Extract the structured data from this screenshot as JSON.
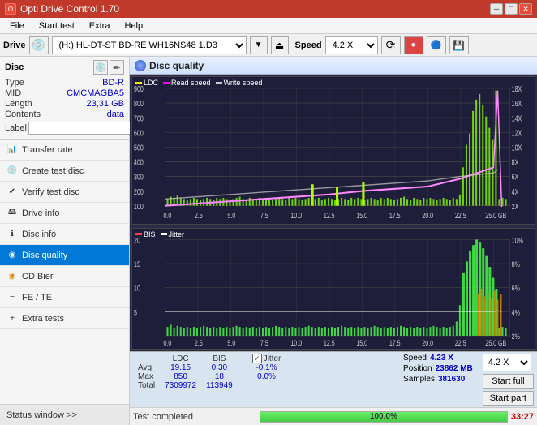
{
  "titleBar": {
    "title": "Opti Drive Control 1.70",
    "minBtn": "─",
    "maxBtn": "□",
    "closeBtn": "✕"
  },
  "menuBar": {
    "items": [
      "File",
      "Start test",
      "Extra",
      "Help"
    ]
  },
  "driveBar": {
    "label": "Drive",
    "driveValue": "(H:) HL-DT-ST BD-RE  WH16NS48 1.D3",
    "speedLabel": "Speed",
    "speedValue": "4.2 X"
  },
  "sidebar": {
    "discTitle": "Disc",
    "discInfo": {
      "type": {
        "key": "Type",
        "val": "BD-R"
      },
      "mid": {
        "key": "MID",
        "val": "CMCMAGBA5"
      },
      "length": {
        "key": "Length",
        "val": "23,31 GB"
      },
      "contents": {
        "key": "Contents",
        "val": "data"
      },
      "label": "Label"
    },
    "navItems": [
      {
        "id": "transfer-rate",
        "label": "Transfer rate",
        "active": false
      },
      {
        "id": "create-test-disc",
        "label": "Create test disc",
        "active": false
      },
      {
        "id": "verify-test-disc",
        "label": "Verify test disc",
        "active": false
      },
      {
        "id": "drive-info",
        "label": "Drive info",
        "active": false
      },
      {
        "id": "disc-info",
        "label": "Disc info",
        "active": false
      },
      {
        "id": "disc-quality",
        "label": "Disc quality",
        "active": true
      },
      {
        "id": "cd-bier",
        "label": "CD Bier",
        "active": false
      },
      {
        "id": "fe-te",
        "label": "FE / TE",
        "active": false
      },
      {
        "id": "extra-tests",
        "label": "Extra tests",
        "active": false
      }
    ],
    "statusWindowBtn": "Status window >>"
  },
  "discQuality": {
    "title": "Disc quality",
    "chart1": {
      "legend": [
        {
          "label": "LDC",
          "color": "#ffff00"
        },
        {
          "label": "Read speed",
          "color": "#ff00ff"
        },
        {
          "label": "Write speed",
          "color": "#aaaaaa"
        }
      ],
      "yAxisMax": 900,
      "yAxisLabels": [
        "900",
        "800",
        "700",
        "600",
        "500",
        "400",
        "300",
        "200",
        "100"
      ],
      "xAxisLabels": [
        "0.0",
        "2.5",
        "5.0",
        "7.5",
        "10.0",
        "12.5",
        "15.0",
        "17.5",
        "20.0",
        "22.5",
        "25.0 GB"
      ],
      "rightAxisLabels": [
        "18X",
        "16X",
        "14X",
        "12X",
        "10X",
        "8X",
        "6X",
        "4X",
        "2X"
      ]
    },
    "chart2": {
      "legend": [
        {
          "label": "BIS",
          "color": "#ff4444"
        },
        {
          "label": "Jitter",
          "color": "#ffffff"
        }
      ],
      "yAxisMax": 20,
      "yAxisLabels": [
        "20",
        "15",
        "10",
        "5"
      ],
      "xAxisLabels": [
        "0.0",
        "2.5",
        "5.0",
        "7.5",
        "10.0",
        "12.5",
        "15.0",
        "17.5",
        "20.0",
        "22.5",
        "25.0 GB"
      ],
      "rightAxisLabels": [
        "10%",
        "8%",
        "6%",
        "4%",
        "2%"
      ]
    }
  },
  "stats": {
    "columns": [
      "LDC",
      "BIS",
      "",
      "Jitter",
      "Speed",
      "4.23 X"
    ],
    "rows": [
      {
        "label": "Avg",
        "ldc": "19.15",
        "bis": "0.30",
        "jitter": "-0.1%"
      },
      {
        "label": "Max",
        "ldc": "850",
        "bis": "18",
        "jitter": "0.0%"
      },
      {
        "label": "Total",
        "ldc": "7309972",
        "bis": "113949",
        "jitter": ""
      }
    ],
    "speedDropdown": "4.2 X",
    "jitterChecked": true,
    "position": {
      "label": "Position",
      "val": "23862 MB"
    },
    "samples": {
      "label": "Samples",
      "val": "381630"
    },
    "startFull": "Start full",
    "startPart": "Start part"
  },
  "statusBar": {
    "text": "Test completed",
    "progress": 100,
    "progressText": "100.0%",
    "time": "33:27"
  }
}
